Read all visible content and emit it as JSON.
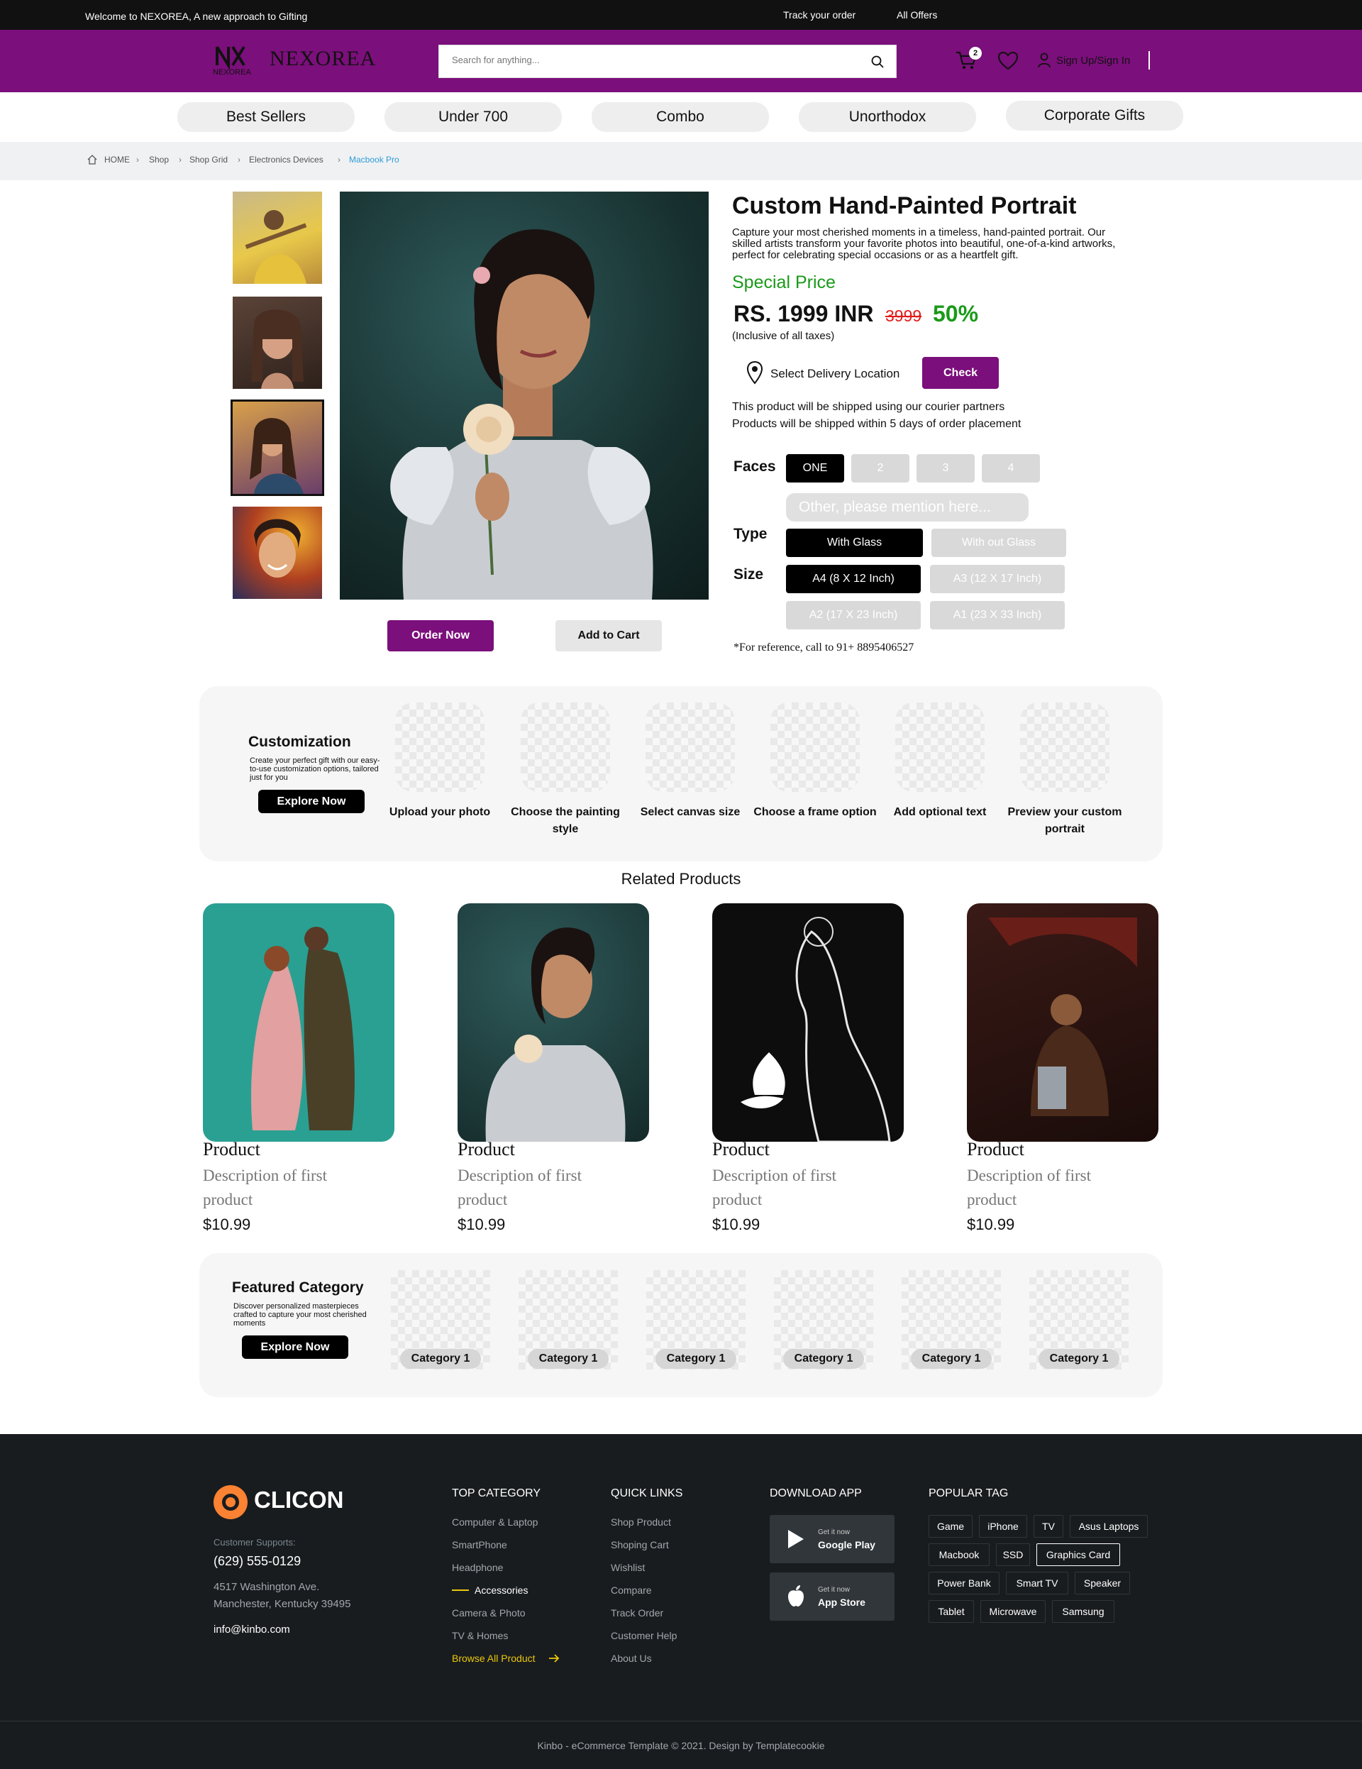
{
  "topbar": {
    "welcome": "Welcome to NEXOREA, A new approach to Gifting",
    "track": "Track your order",
    "offers": "All Offers"
  },
  "header": {
    "logo_text": "NEXOREA",
    "brand": "NEXOREA",
    "search_placeholder": "Search for anything...",
    "cart_count": "2",
    "signin": "Sign Up/Sign In"
  },
  "categories": [
    "Best Sellers",
    "Under 700",
    "Combo",
    "Unorthodox",
    "Corporate Gifts"
  ],
  "breadcrumb": [
    "HOME",
    "Shop",
    "Shop Grid",
    "Electronics Devices",
    "Macbook Pro"
  ],
  "product": {
    "title": "Custom Hand-Painted Portrait",
    "description": "Capture your most cherished moments in a timeless, hand-painted portrait. Our skilled artists transform your favorite photos into beautiful, one-of-a-kind artworks, perfect for celebrating special occasions or as a heartfelt gift.",
    "special_label": "Special Price",
    "price": "RS. 1999 INR",
    "old_price": "3999",
    "discount": "50%",
    "inclusive": "(Inclusive of all taxes)",
    "delivery_label": "Select Delivery Location",
    "check_label": "Check",
    "ship_line1": "This product will be shipped using our courier partners",
    "ship_line2": "Products will be shipped within 5 days of order placement",
    "faces_label": "Faces",
    "faces": [
      "ONE",
      "2",
      "3",
      "4"
    ],
    "other_placeholder": "Other, please mention here...",
    "type_label": "Type",
    "types": [
      "With Glass",
      "With out Glass"
    ],
    "size_label": "Size",
    "sizes": [
      "A4 (8 X 12 Inch)",
      "A3 (12 X 17 Inch)",
      "A2 (17 X 23 Inch)",
      "A1 (23 X 33 Inch)"
    ],
    "reference": "*For reference, call to 91+ 8895406527",
    "order_label": "Order Now",
    "cart_label": "Add to Cart"
  },
  "customization": {
    "title": "Customization",
    "description": "Create your perfect gift with our easy-to-use customization options, tailored just for you",
    "button": "Explore Now",
    "steps": [
      "Upload your photo",
      "Choose the painting style",
      "Select canvas size",
      "Choose a frame option",
      "Add optional text",
      "Preview your custom portrait"
    ]
  },
  "related": {
    "title": "Related Products",
    "items": [
      {
        "name": "Product",
        "desc": "Description of first product",
        "price": "$10.99"
      },
      {
        "name": "Product",
        "desc": "Description of first product",
        "price": "$10.99"
      },
      {
        "name": "Product",
        "desc": "Description of first product",
        "price": "$10.99"
      },
      {
        "name": "Product",
        "desc": "Description of first product",
        "price": "$10.99"
      }
    ]
  },
  "featured": {
    "title": "Featured Category",
    "description": "Discover personalized masterpieces crafted to capture your most cherished moments",
    "button": "Explore Now",
    "categories": [
      "Category 1",
      "Category 1",
      "Category 1",
      "Category 1",
      "Category 1",
      "Category 1"
    ]
  },
  "footer": {
    "brand": "CLICON",
    "support_label": "Customer Supports:",
    "phone": "(629) 555-0129",
    "address1": "4517 Washington Ave.",
    "address2": "Manchester, Kentucky 39495",
    "email": "info@kinbo.com",
    "top_category": {
      "title": "TOP CATEGORY",
      "links": [
        "Computer & Laptop",
        "SmartPhone",
        "Headphone",
        "Accessories",
        "Camera & Photo",
        "TV & Homes"
      ],
      "browse": "Browse All Product"
    },
    "quick_links": {
      "title": "QUICK LINKS",
      "links": [
        "Shop Product",
        "Shoping Cart",
        "Wishlist",
        "Compare",
        "Track Order",
        "Customer Help",
        "About Us"
      ]
    },
    "download": {
      "title": "DOWNLOAD APP",
      "google_small": "Get it now",
      "google_big": "Google Play",
      "apple_small": "Get it now",
      "apple_big": "App Store"
    },
    "tags": {
      "title": "POPULAR TAG",
      "items": [
        "Game",
        "iPhone",
        "TV",
        "Asus Laptops",
        "Macbook",
        "SSD",
        "Graphics Card",
        "Power Bank",
        "Smart TV",
        "Speaker",
        "Tablet",
        "Microwave",
        "Samsung"
      ]
    },
    "copyright": "Kinbo - eCommerce Template © 2021. Design by Templatecookie"
  },
  "colors": {
    "brand_purple": "#7b0f7b",
    "special_green": "#1a9a1a",
    "old_price_red": "#e21b1b",
    "footer_bg": "#191c1f",
    "accent_orange": "#fa8232"
  }
}
